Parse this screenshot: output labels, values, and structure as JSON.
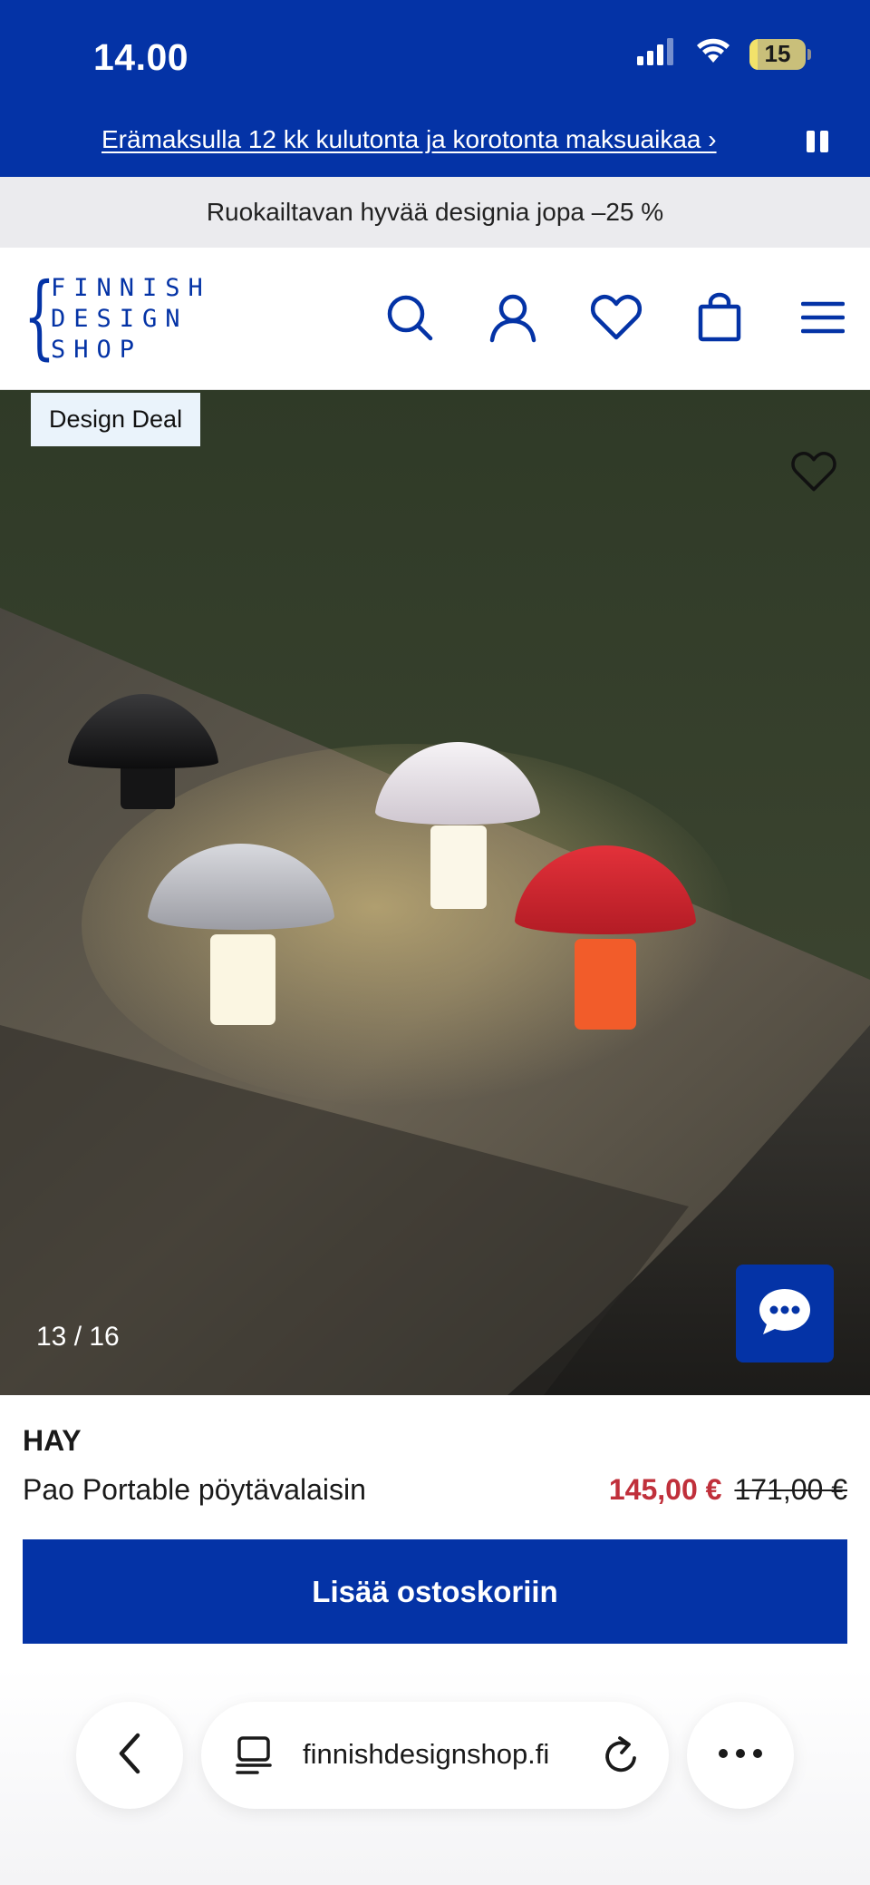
{
  "status_bar": {
    "time": "14.00",
    "battery_percent": "15",
    "battery_level": 0.15,
    "icons": [
      "signal-icon",
      "wifi-icon",
      "battery-icon"
    ]
  },
  "promo": {
    "text": "Erämaksulla 12 kk kulutonta ja korotonta maksuaikaa ›",
    "pause_icon": "pause-icon"
  },
  "sale_banner": {
    "text": "Ruokailtavan hyvää designia jopa –25 %"
  },
  "header": {
    "logo": {
      "line1": "FINNISH",
      "line2": "DESIGN",
      "line3": "SHOP"
    },
    "icons": [
      "search-icon",
      "account-icon",
      "wishlist-icon",
      "cart-icon",
      "menu-icon"
    ]
  },
  "product_image": {
    "badge": "Design Deal",
    "counter": "13 / 16",
    "heart_icon": "heart-icon",
    "chat_icon": "chat-icon"
  },
  "product": {
    "brand": "HAY",
    "name": "Pao Portable pöytävalaisin",
    "price": "145,00 €",
    "old_price": "171,00 €",
    "add_to_cart": "Lisää ostoskoriin"
  },
  "browser": {
    "url": "finnishdesignshop.fi",
    "icons": [
      "back-icon",
      "tabs-icon",
      "reload-icon",
      "more-icon"
    ]
  },
  "colors": {
    "brand_blue": "#0433a6",
    "sale_red": "#c0303b",
    "banner_grey": "#ebebee"
  }
}
